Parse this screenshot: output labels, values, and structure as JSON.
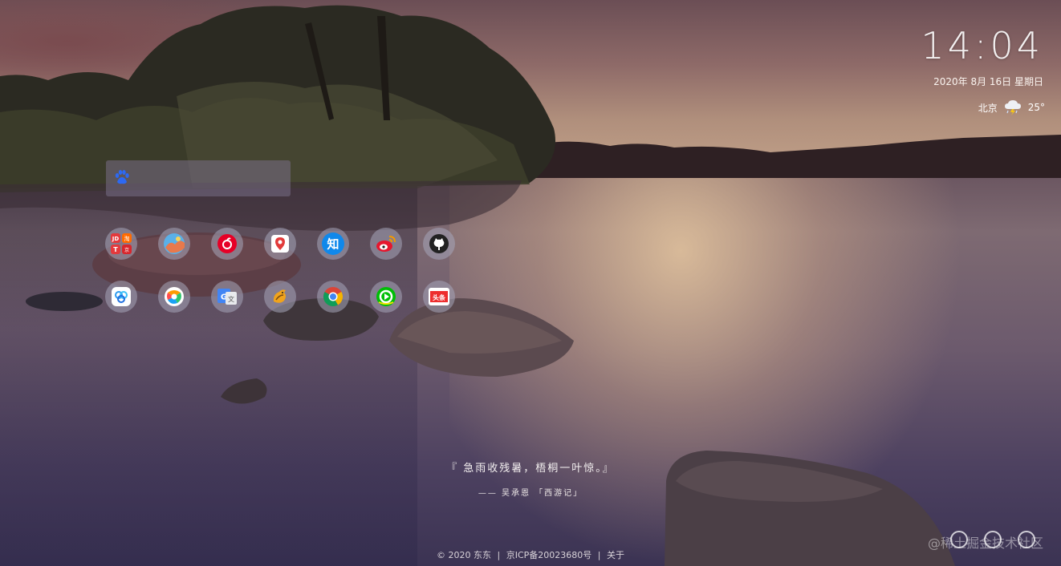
{
  "clock": {
    "time": "14:04",
    "date": "2020年 8月 16日 星期日"
  },
  "weather": {
    "city": "北京",
    "temperature": "25°",
    "icon": "thunderstorm-cloud-icon"
  },
  "search": {
    "engine_icon": "baidu-paw-icon",
    "placeholder": "",
    "value": ""
  },
  "shortcuts": [
    {
      "name": "jd-taobao-icon",
      "label": "JD / 淘 / T / 京"
    },
    {
      "name": "photo-app-icon"
    },
    {
      "name": "netease-music-icon"
    },
    {
      "name": "map-pin-icon"
    },
    {
      "name": "zhihu-icon",
      "label": "知"
    },
    {
      "name": "weibo-icon"
    },
    {
      "name": "github-icon"
    },
    {
      "name": "baidu-cloud-icon"
    },
    {
      "name": "tencent-video-icon"
    },
    {
      "name": "google-translate-icon",
      "label": "G"
    },
    {
      "name": "bird-app-icon"
    },
    {
      "name": "chrome-icon"
    },
    {
      "name": "iqiyi-icon"
    },
    {
      "name": "toutiao-icon",
      "label": "头条"
    }
  ],
  "quote": {
    "text": "『 急雨收残暑，梧桐一叶惊。』",
    "author": "—— 吴承恩 「西游记」"
  },
  "footer": {
    "copyright": "© 2020 东东",
    "icp": "京ICP备20023680号",
    "about": "关于"
  },
  "watermark": "@稀土掘金技术社区",
  "colors": {
    "sky_top": "#6b4e55",
    "glow": "#e8c8a0",
    "water_dark": "#3b3353"
  }
}
